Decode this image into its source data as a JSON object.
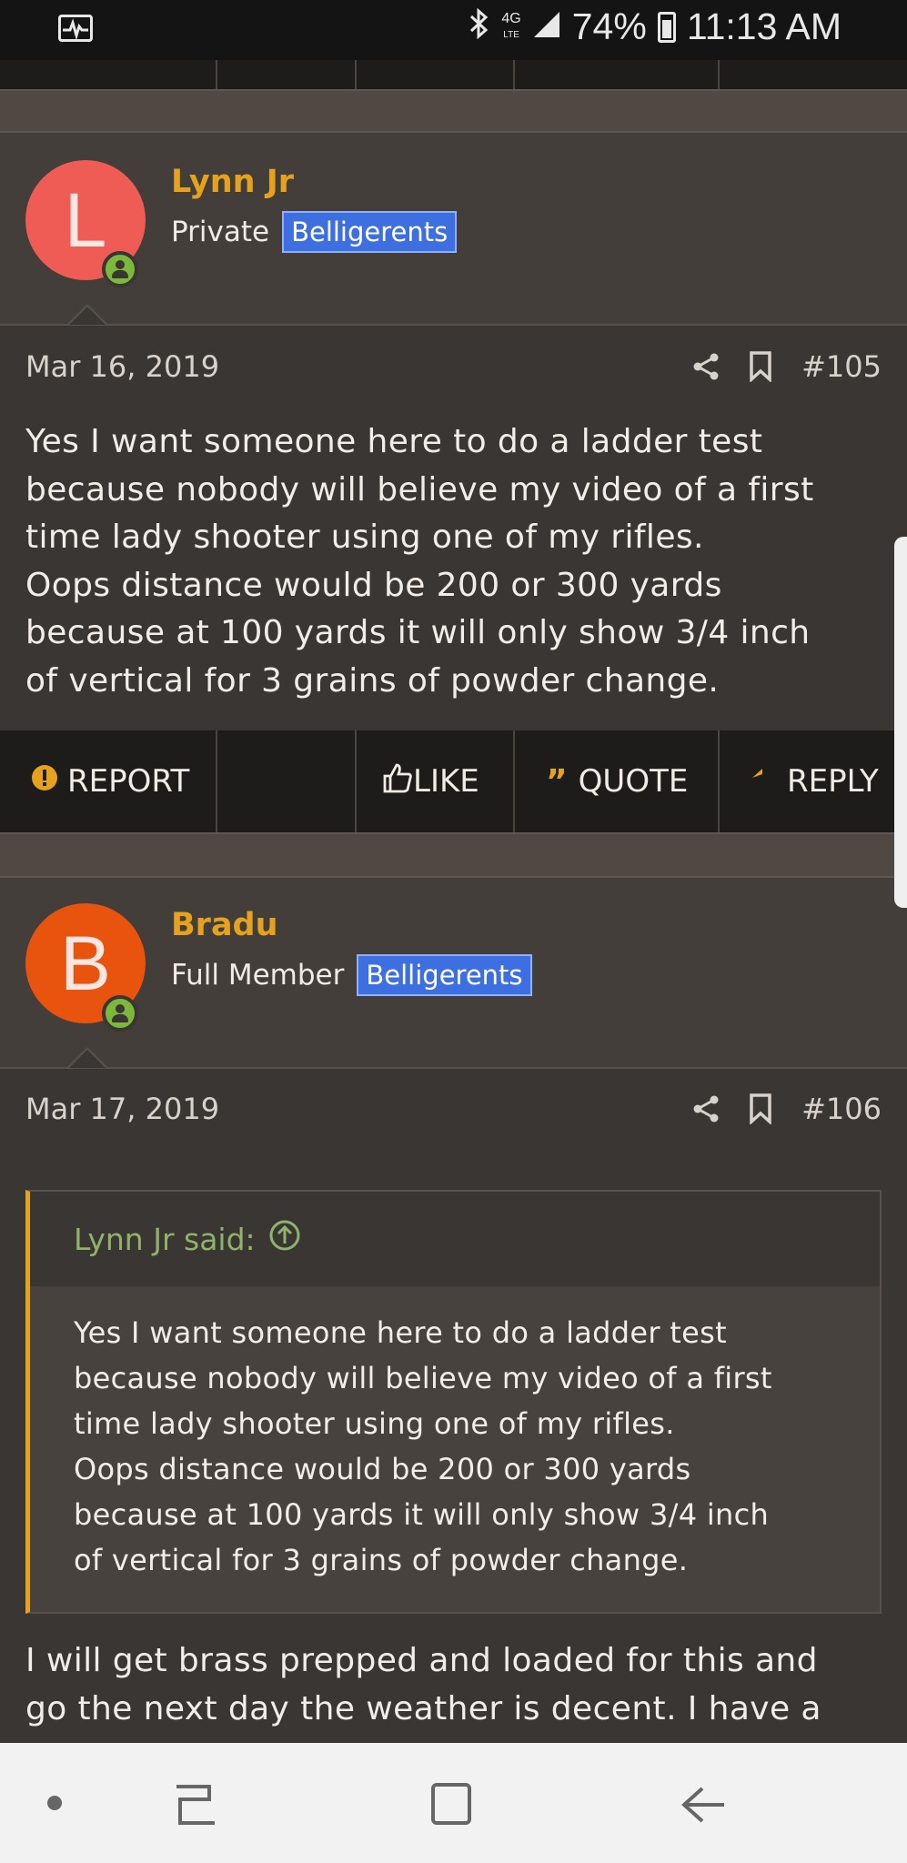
{
  "status": {
    "network": "4G",
    "network_sub": "LTE",
    "battery": "74%",
    "time": "11:13 AM"
  },
  "posts": [
    {
      "author": "Lynn Jr",
      "avatar_letter": "L",
      "avatar_color": "#ef5b55",
      "title": "Private",
      "badge": "Belligerents",
      "date": "Mar 16, 2019",
      "number": "#105",
      "lines": [
        "Yes I want someone here to do a ladder test",
        "because nobody will believe my video of a first",
        "time lady shooter using one of my rifles.",
        "Oops distance would be 200 or 300 yards",
        "because at 100 yards it will only show 3/4 inch",
        "of vertical for 3 grains of powder change."
      ]
    },
    {
      "author": "Bradu",
      "avatar_letter": "B",
      "avatar_color": "#e8540e",
      "title": "Full Member",
      "badge": "Belligerents",
      "date": "Mar 17, 2019",
      "number": "#106",
      "quote_author": "Lynn Jr said:",
      "quote_lines": [
        "Yes I want someone here to do a ladder test",
        "because nobody will believe my video of a first",
        "time lady shooter using one of my rifles.",
        "Oops distance would be 200 or 300 yards",
        "because at 100 yards it will only show 3/4 inch",
        "of vertical for 3 grains of powder change."
      ],
      "lines": [
        "I will get brass prepped and loaded for this and",
        "go the next day the weather is decent. I have a"
      ]
    }
  ],
  "actions": {
    "report": "REPORT",
    "like": "LIKE",
    "quote": "QUOTE",
    "reply": "REPLY"
  },
  "colors": {
    "accent": "#e5a21c",
    "badge": "#3d6fe0",
    "online": "#7cb83b",
    "quote_author": "#8fb368"
  }
}
